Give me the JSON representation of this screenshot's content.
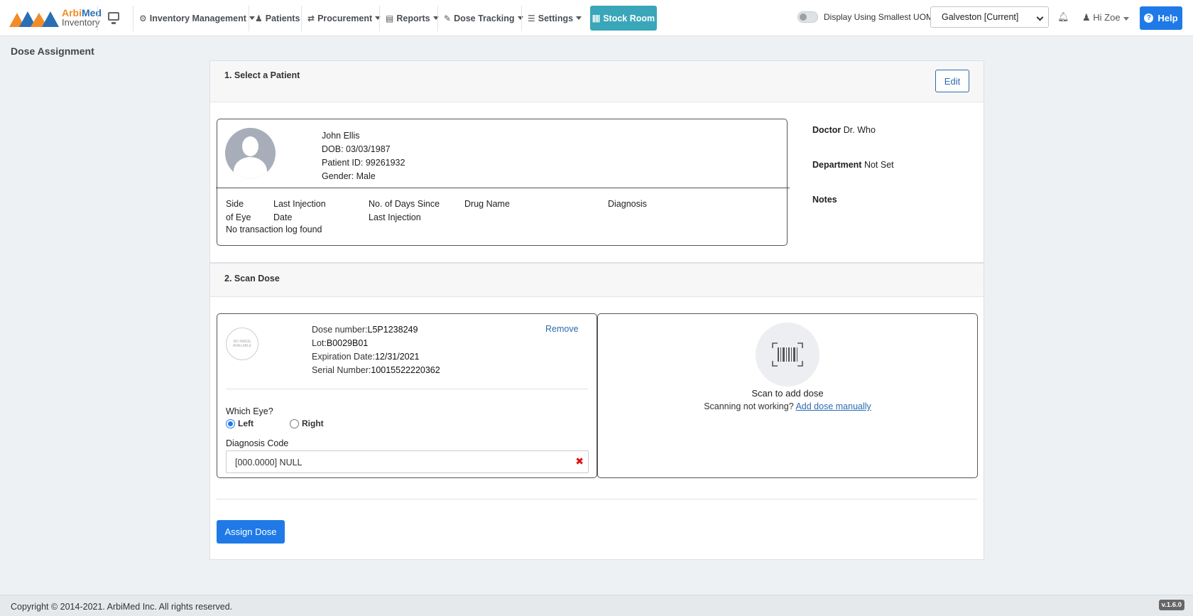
{
  "brand": {
    "name_part1": "Arbi",
    "name_part2": "Med",
    "subtitle": "Inventory"
  },
  "nav": {
    "items": [
      {
        "label": "Inventory Management"
      },
      {
        "label": "Patients"
      },
      {
        "label": "Procurement"
      },
      {
        "label": "Reports"
      },
      {
        "label": "Dose Tracking"
      },
      {
        "label": "Settings"
      }
    ],
    "stock_room": "Stock Room",
    "toggle_label": "Display Using Smallest UOM",
    "location": "Galveston [Current]",
    "user": "Hi Zoe",
    "help": "Help"
  },
  "page_title": "Dose Assignment",
  "select_patient": {
    "title": "1. Select a Patient",
    "edit": "Edit",
    "patient": {
      "name": "John Ellis",
      "dob": "DOB: 03/03/1987",
      "patient_id": "Patient ID: 99261932",
      "gender": "Gender: Male"
    },
    "log_columns": [
      {
        "line1": "Side",
        "line2": "of Eye"
      },
      {
        "line1": "Last Injection",
        "line2": "Date"
      },
      {
        "line1": "No. of Days Since",
        "line2": "Last Injection"
      },
      {
        "line1": "Drug Name",
        "line2": ""
      },
      {
        "line1": "Diagnosis",
        "line2": ""
      }
    ],
    "log_empty": "No transaction log found",
    "doctor_label": "Doctor",
    "doctor_value": "Dr. Who",
    "department_label": "Department",
    "department_value": "Not Set",
    "notes_label": "Notes"
  },
  "scan_dose": {
    "title": "2. Scan Dose",
    "no_image": "NO IMAGE AVAILABLE",
    "dose_number_label": "Dose number:",
    "dose_number": "L5P1238249",
    "lot_label": "Lot:",
    "lot": "B0029B01",
    "expiration_label": "Expiration Date:",
    "expiration": "12/31/2021",
    "serial_label": "Serial Number:",
    "serial": "10015522220362",
    "remove": "Remove",
    "which_eye": "Which Eye?",
    "eye_left": "Left",
    "eye_right": "Right",
    "selected_eye": "Left",
    "diagnosis_label": "Diagnosis Code",
    "diagnosis_value": "[000.0000] NULL",
    "scan_title": "Scan to add dose",
    "scan_sub": "Scanning not working?",
    "scan_link": "Add dose manually",
    "assign": "Assign Dose"
  },
  "footer": {
    "copyright": "Copyright © 2014-2021. ArbiMed Inc. All rights reserved.",
    "version": "v.1.6.0"
  },
  "colors": {
    "primary": "#1f7ae8",
    "stock_room": "#3aa6b9",
    "brand_orange": "#f28c28",
    "brand_blue": "#2a6fb6",
    "danger": "#dd1111"
  }
}
